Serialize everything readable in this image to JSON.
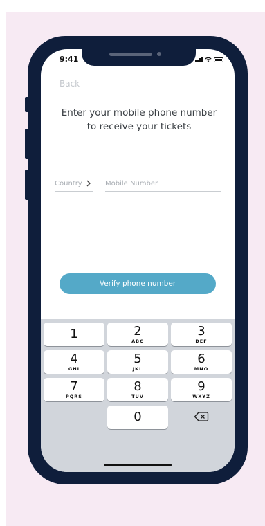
{
  "status": {
    "time": "9:41"
  },
  "nav": {
    "back_label": "Back"
  },
  "form": {
    "heading_line1": "Enter your mobile phone number",
    "heading_line2": "to receive your tickets",
    "country_label": "Country",
    "mobile_placeholder": "Mobile Number",
    "mobile_value": "",
    "verify_label": "Verify phone number"
  },
  "keypad": {
    "keys": [
      {
        "digit": "1",
        "letters": ""
      },
      {
        "digit": "2",
        "letters": "ABC"
      },
      {
        "digit": "3",
        "letters": "DEF"
      },
      {
        "digit": "4",
        "letters": "GHI"
      },
      {
        "digit": "5",
        "letters": "JKL"
      },
      {
        "digit": "6",
        "letters": "MNO"
      },
      {
        "digit": "7",
        "letters": "PQRS"
      },
      {
        "digit": "8",
        "letters": "TUV"
      },
      {
        "digit": "9",
        "letters": "WXYZ"
      },
      {
        "digit": "0",
        "letters": ""
      }
    ],
    "delete_icon": "backspace-icon"
  },
  "colors": {
    "background": "#f7eaf3",
    "phone_frame": "#0f1e3b",
    "accent": "#54a9c8",
    "keypad_bg": "#d1d5db"
  }
}
